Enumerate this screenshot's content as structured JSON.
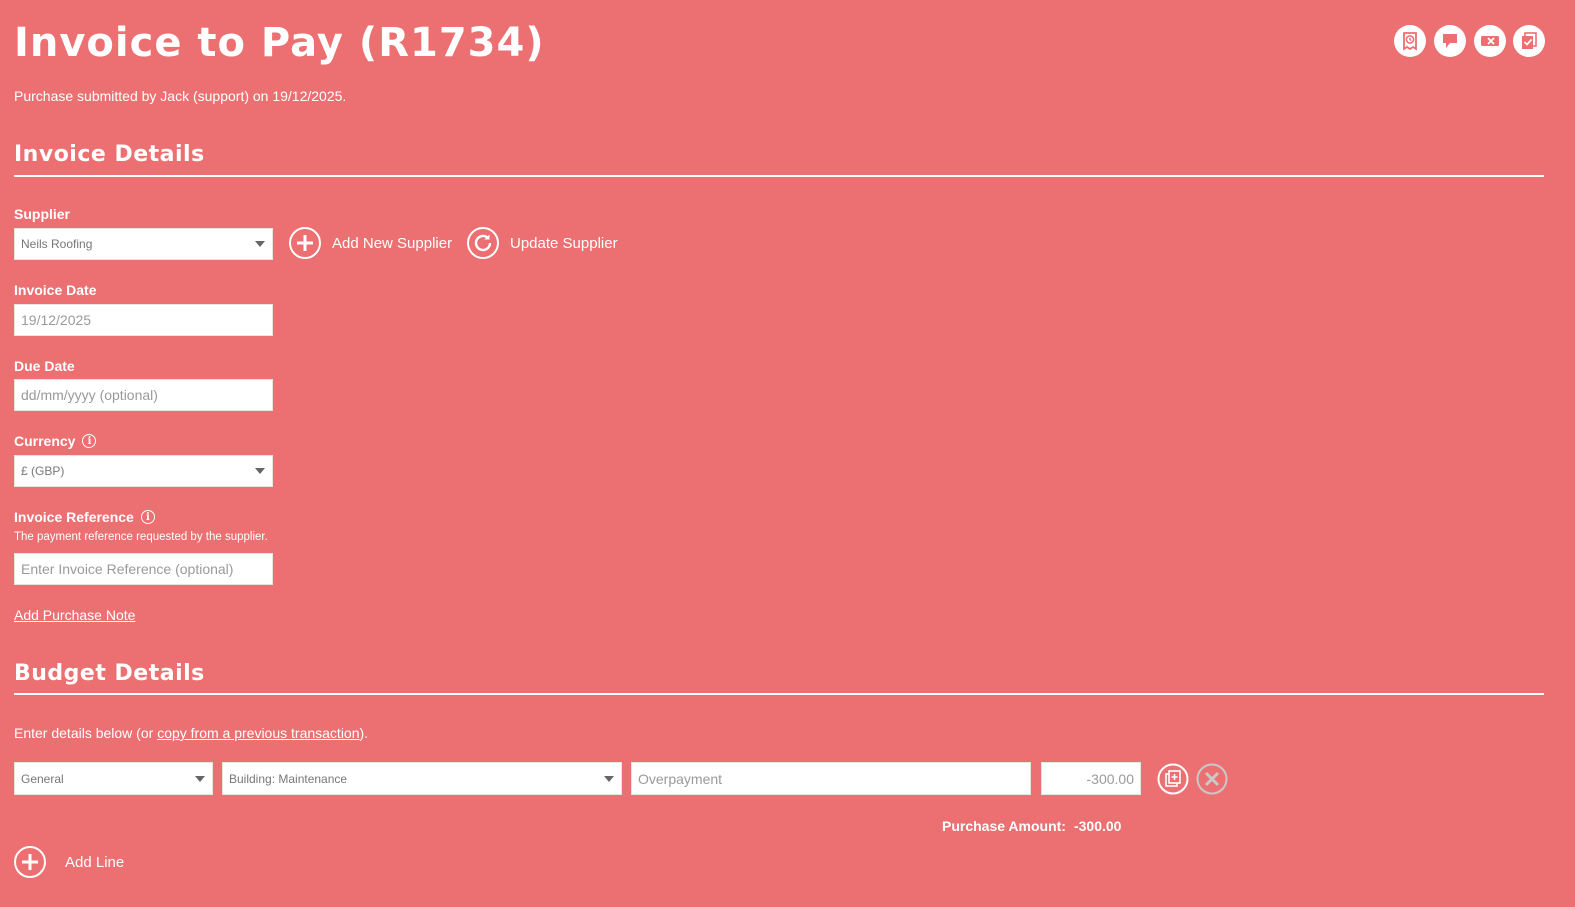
{
  "header": {
    "title": "Invoice to Pay (R1734)",
    "subtitle": "Purchase submitted by Jack (support) on 19/12/2025.",
    "icons": [
      "receipt-clock-icon",
      "comment-icon",
      "discard-icon",
      "approve-icon"
    ]
  },
  "invoice_details": {
    "heading": "Invoice Details",
    "supplier": {
      "label": "Supplier",
      "value": "Neils Roofing",
      "add_label": "Add New Supplier",
      "update_label": "Update Supplier"
    },
    "invoice_date": {
      "label": "Invoice Date",
      "value": "19/12/2025"
    },
    "due_date": {
      "label": "Due Date",
      "placeholder": "dd/mm/yyyy (optional)"
    },
    "currency": {
      "label": "Currency",
      "value": "£ (GBP)"
    },
    "invoice_reference": {
      "label": "Invoice Reference",
      "help": "The payment reference requested by the supplier.",
      "placeholder": "Enter Invoice Reference (optional)"
    },
    "add_note_label": "Add Purchase Note"
  },
  "budget_details": {
    "heading": "Budget Details",
    "intro_prefix": "Enter details below (or ",
    "intro_link": "copy from a previous transaction",
    "intro_suffix": ").",
    "line": {
      "budget": "General",
      "category": "Building: Maintenance",
      "description": "Overpayment",
      "amount": "-300.00"
    },
    "total_label": "Purchase Amount:",
    "total_value": "-300.00",
    "add_line_label": "Add Line"
  },
  "colors": {
    "background": "#ec6f71",
    "text": "#ffffff",
    "field": "#ffffff"
  }
}
